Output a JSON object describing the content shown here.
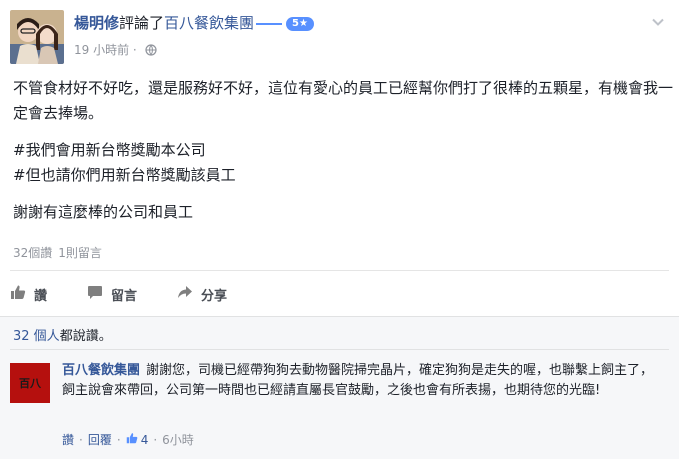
{
  "post": {
    "author": "楊明修",
    "action": "評論了",
    "page_name": "百八餐飲集團",
    "rating": "5★",
    "timestamp": "19 小時前",
    "paragraphs": [
      "不管食材好不好吃，還是服務好不好，這位有愛心的員工已經幫你們打了很棒的五顆星，有機會我一定會去捧場。",
      "#我們會用新台幣獎勵本公司",
      "#但也請你們用新台幣獎勵該員工",
      "謝謝有這麼棒的公司和員工"
    ],
    "like_count_text": "32個讚",
    "comment_count_text": "1則留言"
  },
  "actions": {
    "like": "讚",
    "comment": "留言",
    "share": "分享"
  },
  "comments_panel": {
    "likes_count": "32 個人",
    "likes_suffix": "都說讚。",
    "reply": {
      "author": "百八餐飲集團",
      "avatar_text": "百八",
      "text": "謝謝您，司機已經帶狗狗去動物醫院掃完晶片，確定狗狗是走失的喔，也聯繫上飼主了，飼主說會來帶回，公司第一時間也已經請直屬長官鼓勵，之後也會有所表揚，也期待您的光臨!",
      "like_label": "讚",
      "reply_label": "回覆",
      "likes": "4",
      "time": "6小時"
    }
  },
  "colors": {
    "link": "#365899",
    "rating_badge": "#5890ff",
    "muted": "#90949c"
  }
}
